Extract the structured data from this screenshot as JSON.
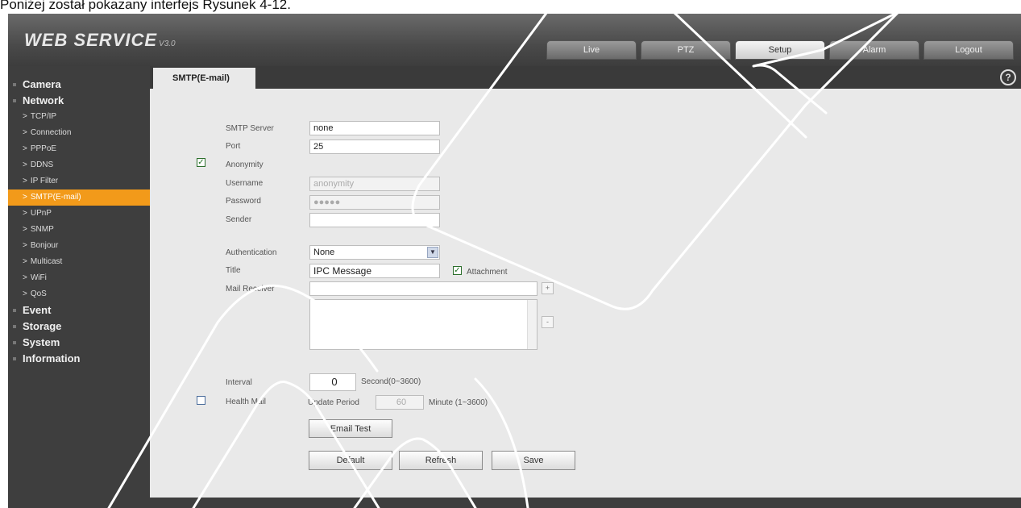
{
  "caption": "Poniżej został pokazany interfejs Rysunek 4-12.",
  "app": {
    "logo_main": "WEB SERVICE",
    "logo_version": "V3.0"
  },
  "top_tabs": [
    "Live",
    "PTZ",
    "Setup",
    "Alarm",
    "Logout"
  ],
  "active_top_tab": "Setup",
  "sidebar": {
    "camera": "Camera",
    "network": "Network",
    "network_items": [
      "TCP/IP",
      "Connection",
      "PPPoE",
      "DDNS",
      "IP Filter",
      "SMTP(E-mail)",
      "UPnP",
      "SNMP",
      "Bonjour",
      "Multicast",
      "WiFi",
      "QoS"
    ],
    "active_item": "SMTP(E-mail)",
    "event": "Event",
    "storage": "Storage",
    "system": "System",
    "information": "Information"
  },
  "content_tab": "SMTP(E-mail)",
  "help_icon": "?",
  "form": {
    "smtp_server_label": "SMTP Server",
    "smtp_server_value": "none",
    "port_label": "Port",
    "port_value": "25",
    "anonymity_label": "Anonymity",
    "anonymity_checked": true,
    "username_label": "Username",
    "username_value": "anonymity",
    "password_label": "Password",
    "password_value": "●●●●●",
    "sender_label": "Sender",
    "sender_value": "",
    "authentication_label": "Authentication",
    "authentication_value": "None",
    "title_label": "Title",
    "title_value": "IPC Message",
    "attachment_label": "Attachment",
    "attachment_checked": true,
    "mail_receiver_label": "Mail Receiver",
    "add_symbol": "+",
    "remove_symbol": "-",
    "interval_label": "Interval",
    "interval_value": "0",
    "interval_unit": "Second(0~3600)",
    "health_mail_label": "Health Mail",
    "health_mail_checked": false,
    "update_period_label": "Update Period",
    "update_period_value": "60",
    "update_period_unit": "Minute (1~3600)"
  },
  "buttons": {
    "email_test": "Email Test",
    "default": "Default",
    "refresh": "Refresh",
    "save": "Save"
  },
  "colors": {
    "accent": "#f29a1a",
    "sidebar_bg": "#3e3e3e",
    "content_bg": "#e9e9e9"
  }
}
